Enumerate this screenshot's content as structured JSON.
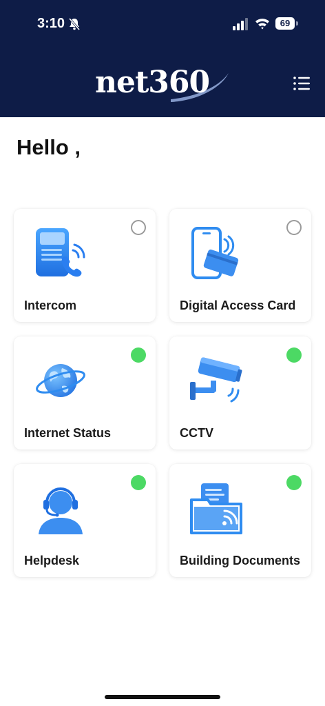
{
  "status_bar": {
    "time": "3:10",
    "battery": "69"
  },
  "header": {
    "logo_text": "net360",
    "menu_icon": "menu-list-icon"
  },
  "greeting": "Hello ,",
  "colors": {
    "header_bg": "#0e1c47",
    "accent_blue": "#2f8cf0",
    "status_on": "#4cd964",
    "status_off": "#9a9a9a"
  },
  "tiles": [
    {
      "label": "Intercom",
      "icon": "intercom-phone-icon",
      "status": "off"
    },
    {
      "label": "Digital Access Card",
      "icon": "access-card-icon",
      "status": "off"
    },
    {
      "label": "Internet Status",
      "icon": "globe-icon",
      "status": "on"
    },
    {
      "label": "CCTV",
      "icon": "cctv-camera-icon",
      "status": "on"
    },
    {
      "label": "Helpdesk",
      "icon": "headset-agent-icon",
      "status": "on"
    },
    {
      "label": "Building Documents",
      "icon": "document-folder-icon",
      "status": "on"
    }
  ]
}
